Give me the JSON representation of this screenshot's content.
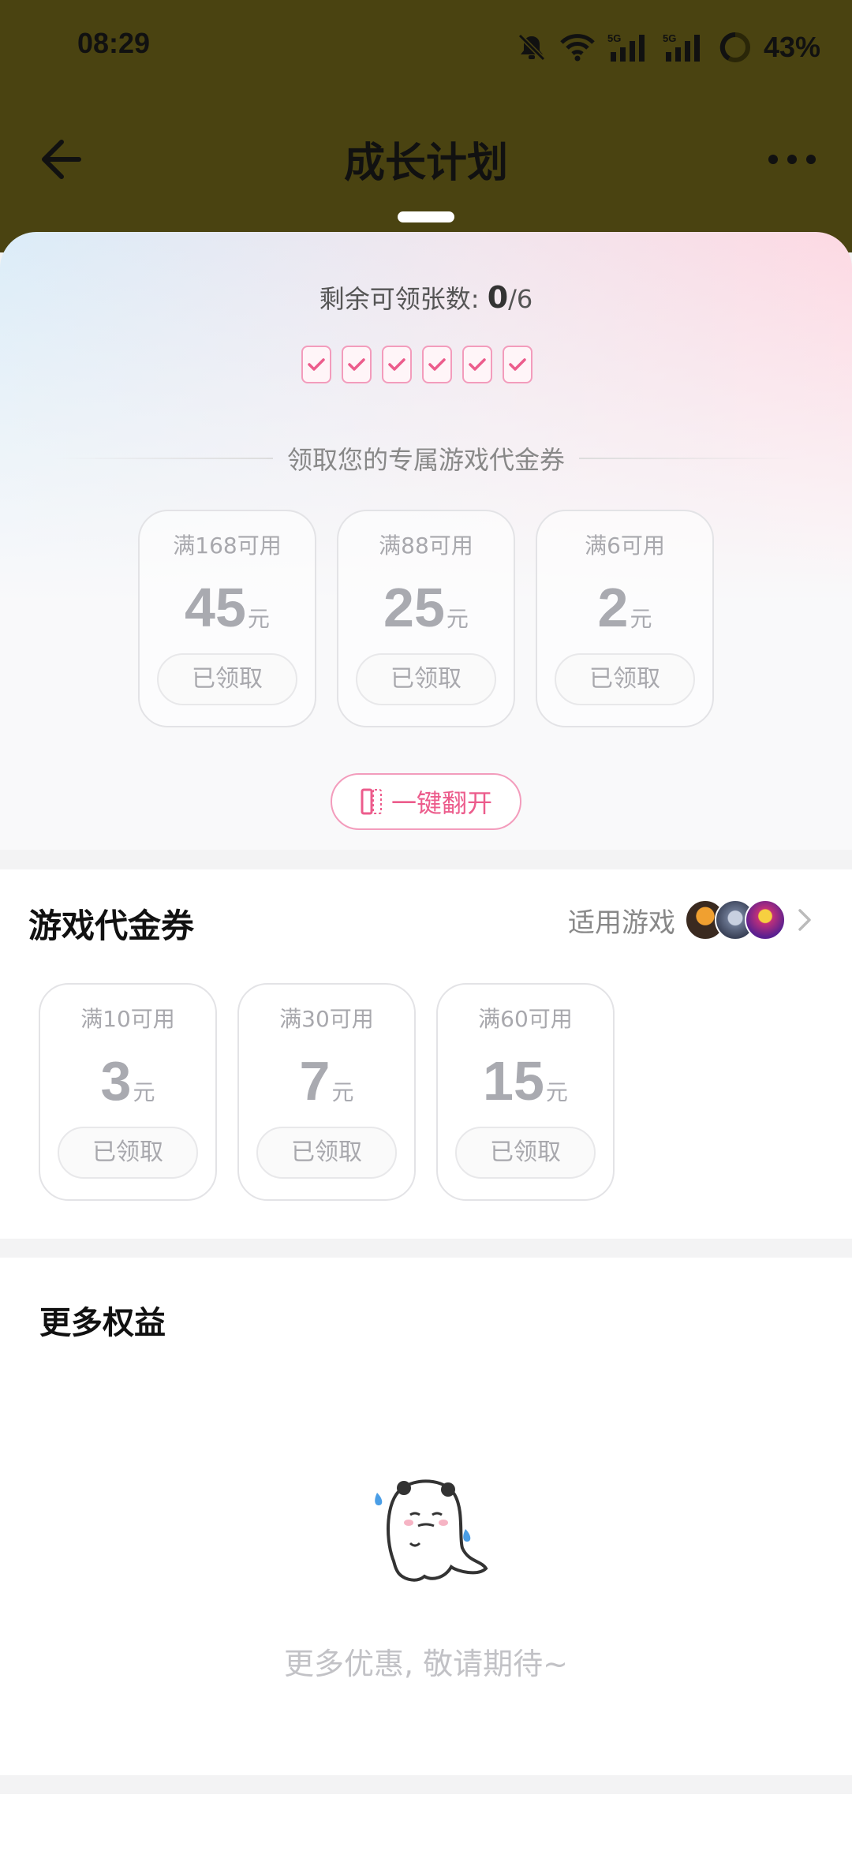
{
  "status_bar": {
    "time": "08:29",
    "battery_percent": "43%",
    "icons": [
      "bell-muted-icon",
      "wifi-icon",
      "signal-5g-icon",
      "signal-5g-icon",
      "battery-ring-icon"
    ]
  },
  "nav": {
    "title": "成长计划",
    "back_icon": "back-arrow-icon",
    "more_icon": "more-dots-icon"
  },
  "growth": {
    "remain_label": "剩余可领张数: ",
    "remain_count": "0",
    "remain_total": "/6",
    "checked_slots": 6,
    "divider_text": "领取您的专属游戏代金券",
    "coupons": [
      {
        "condition": "满168可用",
        "amount": "45",
        "unit": "元",
        "status": "已领取"
      },
      {
        "condition": "满88可用",
        "amount": "25",
        "unit": "元",
        "status": "已领取"
      },
      {
        "condition": "满6可用",
        "amount": "2",
        "unit": "元",
        "status": "已领取"
      }
    ],
    "flip_button": "一键翻开"
  },
  "game_vouchers": {
    "title": "游戏代金券",
    "applicable_label": "适用游戏",
    "coupons": [
      {
        "condition": "满10可用",
        "amount": "3",
        "unit": "元",
        "status": "已领取"
      },
      {
        "condition": "满30可用",
        "amount": "7",
        "unit": "元",
        "status": "已领取"
      },
      {
        "condition": "满60可用",
        "amount": "15",
        "unit": "元",
        "status": "已领取"
      }
    ]
  },
  "more_benefits": {
    "title": "更多权益",
    "empty_text": "更多优惠, 敬请期待~"
  },
  "colors": {
    "topbar": "#4a4311",
    "accent_pink": "#ec5c8c",
    "coupon_gray": "#a9aab0"
  }
}
